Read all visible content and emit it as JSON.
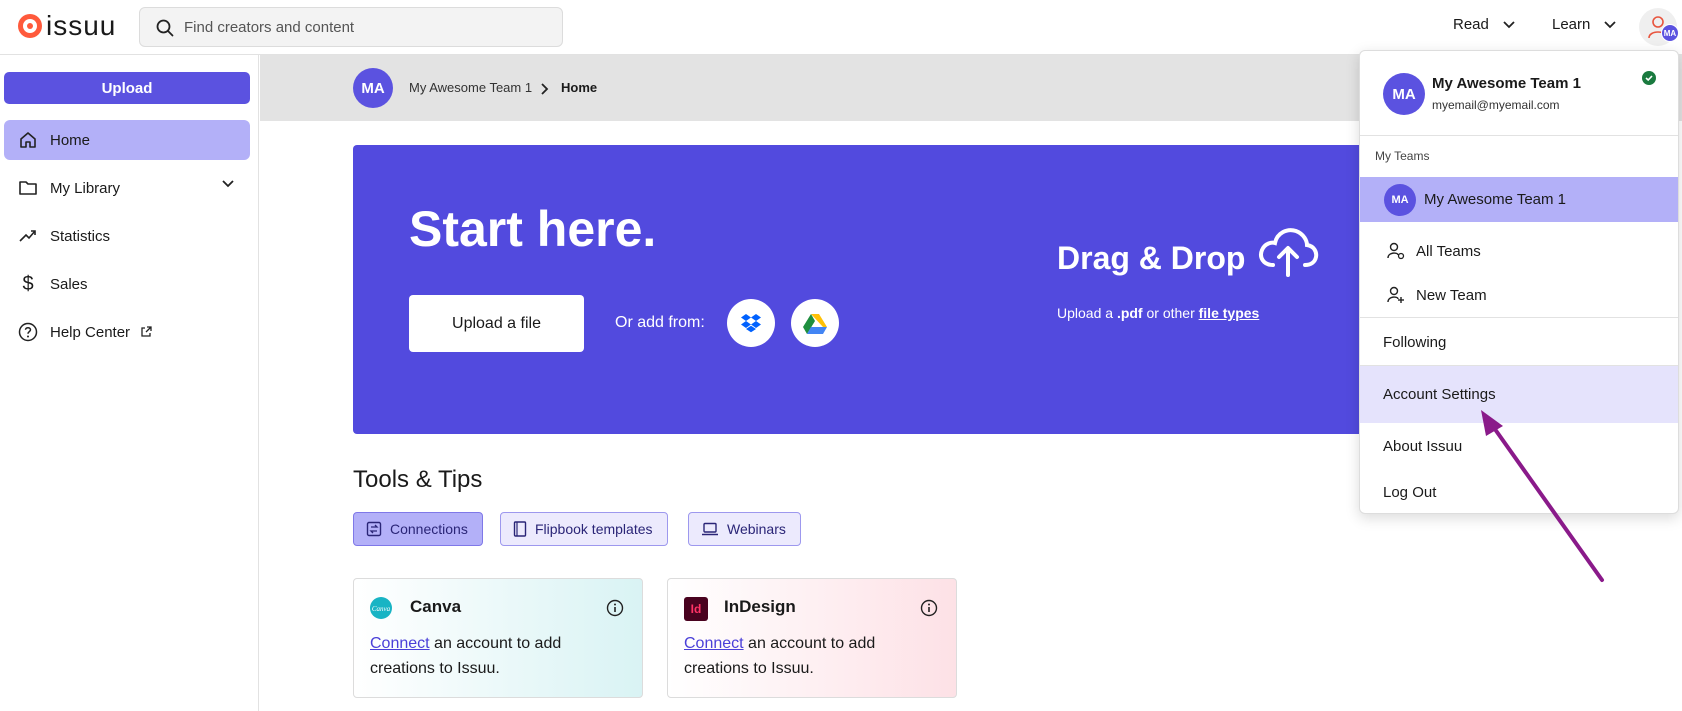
{
  "brand": {
    "name": "issuu",
    "accent": "#5b52e0",
    "logo_color": "#ff5a3c"
  },
  "search": {
    "placeholder": "Find creators and content"
  },
  "topnav": {
    "read": "Read",
    "learn": "Learn",
    "avatar_initials": "MA"
  },
  "sidebar": {
    "upload_label": "Upload",
    "items": [
      {
        "label": "Home",
        "icon": "home-icon",
        "active": true
      },
      {
        "label": "My Library",
        "icon": "folder-icon"
      },
      {
        "label": "Statistics",
        "icon": "trend-icon"
      },
      {
        "label": "Sales",
        "icon": "dollar-icon"
      },
      {
        "label": "Help Center",
        "icon": "help-icon"
      }
    ]
  },
  "breadcrumb": {
    "avatar_initials": "MA",
    "team": "My Awesome Team 1",
    "current": "Home"
  },
  "hero": {
    "title": "Start here.",
    "upload_button": "Upload a file",
    "or_add": "Or add from:",
    "drag_title": "Drag & Drop",
    "drag_sub_prefix": "Upload a ",
    "drag_sub_bold": ".pdf",
    "drag_sub_middle": " or other ",
    "drag_sub_link": "file types"
  },
  "tools": {
    "title": "Tools & Tips",
    "tabs": [
      "Connections",
      "Flipbook templates",
      "Webinars"
    ],
    "cards": [
      {
        "title": "Canva",
        "link": "Connect",
        "text": " an account to add creations to Issuu."
      },
      {
        "title": "InDesign",
        "link": "Connect",
        "text": " an account to add creations to Issuu."
      }
    ],
    "indesign_logo": "Id"
  },
  "dropdown": {
    "avatar_initials": "MA",
    "name": "My Awesome Team 1",
    "email": "myemail@myemail.com",
    "section_label": "My Teams",
    "current_team": "My Awesome Team 1",
    "current_team_initials": "MA",
    "all_teams": "All Teams",
    "new_team": "New Team",
    "following": "Following",
    "account_settings": "Account Settings",
    "about": "About Issuu",
    "logout": "Log Out"
  },
  "annotation": {
    "arrow_color": "#8a1a8a"
  }
}
